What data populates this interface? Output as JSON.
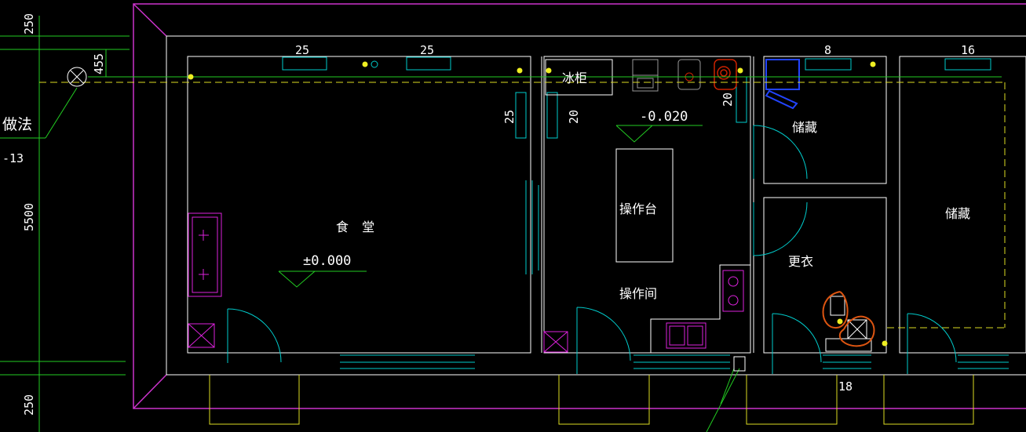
{
  "drawing": {
    "side_labels": {
      "dim_top": "250",
      "dim_bottom": "250",
      "dim_span": "5500",
      "note": "做法",
      "note_code": "-13",
      "light_dim": "455"
    },
    "fixture_sizes": {
      "dining_left": "25",
      "dining_right": "25",
      "dining_wall": "25",
      "kitchen_wall": "20",
      "kitchen_right": "20",
      "storage_top": "8",
      "right_top": "16",
      "bottom_mid": "18"
    },
    "rooms": {
      "dining": "食 堂",
      "kitchen": "操作间",
      "fridge": "冰柜",
      "counter": "操作台",
      "storage_small": "储藏",
      "changing": "更衣",
      "storage_large": "储藏"
    },
    "levels": {
      "dining": "±0.000",
      "kitchen": "-0.020"
    }
  },
  "colors": {
    "background": "#000000",
    "wall": "#ffffff",
    "outer_wall": "#cc33cc",
    "fixture": "#00cccc",
    "green": "#22cc22",
    "yellow": "#dddd22",
    "magenta": "#dd22dd",
    "blue": "#2244ff",
    "orange": "#dd5511",
    "red": "#cc2200"
  }
}
